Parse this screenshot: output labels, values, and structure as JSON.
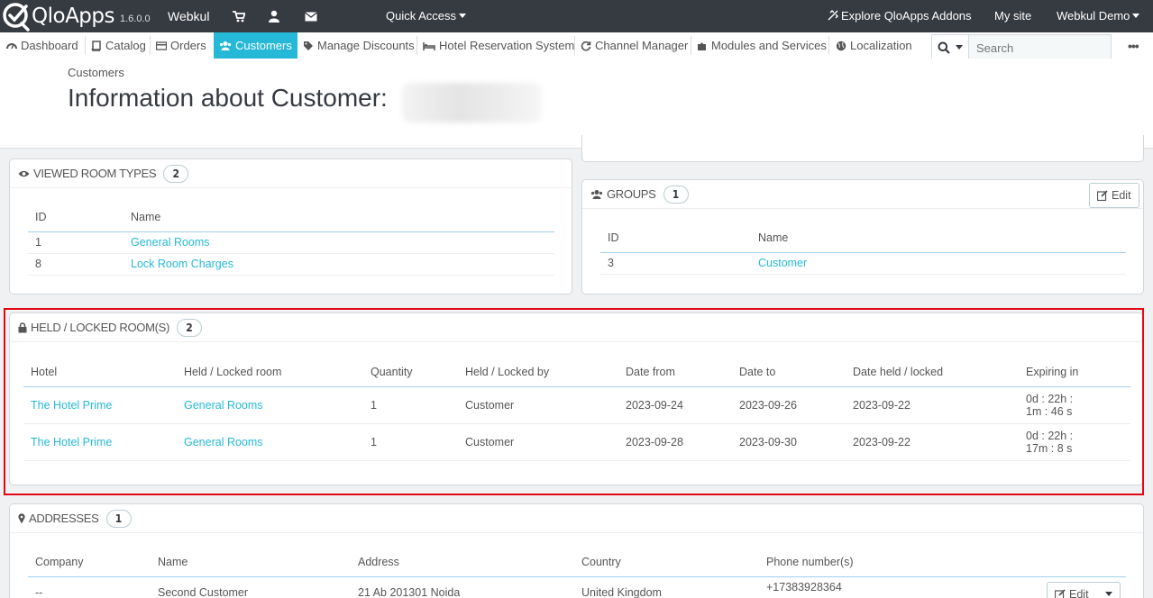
{
  "topbar": {
    "logo": "QloApps",
    "version": "1.6.0.0",
    "user": "Webkul",
    "quick_access": "Quick Access",
    "explore": "Explore QloApps Addons",
    "my_site": "My site",
    "account": "Webkul Demo"
  },
  "nav": {
    "items": [
      "Dashboard",
      "Catalog",
      "Orders",
      "Customers",
      "Manage Discounts",
      "Hotel Reservation System",
      "Channel Manager",
      "Modules and Services",
      "Localization"
    ],
    "active": "Customers",
    "search_placeholder": "Search",
    "more": "•••"
  },
  "header": {
    "breadcrumb": "Customers",
    "title": "Information about Customer:"
  },
  "viewed_room_types": {
    "title": "VIEWED ROOM TYPES",
    "count": "2",
    "columns": [
      "ID",
      "Name"
    ],
    "rows": [
      {
        "id": "1",
        "name": "General Rooms"
      },
      {
        "id": "8",
        "name": "Lock Room Charges"
      }
    ]
  },
  "groups": {
    "title": "GROUPS",
    "count": "1",
    "edit_label": "Edit",
    "columns": [
      "ID",
      "Name"
    ],
    "rows": [
      {
        "id": "3",
        "name": "Customer"
      }
    ]
  },
  "held_rooms": {
    "title": "HELD / LOCKED ROOM(S)",
    "count": "2",
    "columns": [
      "Hotel",
      "Held / Locked room",
      "Quantity",
      "Held / Locked by",
      "Date from",
      "Date to",
      "Date held / locked",
      "Expiring in"
    ],
    "rows": [
      {
        "hotel": "The Hotel Prime",
        "room": "General Rooms",
        "qty": "1",
        "by": "Customer",
        "from": "2023-09-24",
        "to": "2023-09-26",
        "held": "2023-09-22",
        "exp1": "0d : 22h :",
        "exp2": "1m : 46 s"
      },
      {
        "hotel": "The Hotel Prime",
        "room": "General Rooms",
        "qty": "1",
        "by": "Customer",
        "from": "2023-09-28",
        "to": "2023-09-30",
        "held": "2023-09-22",
        "exp1": "0d : 22h :",
        "exp2": "17m : 8 s"
      }
    ]
  },
  "addresses": {
    "title": "ADDRESSES",
    "count": "1",
    "columns": [
      "Company",
      "Name",
      "Address",
      "Country",
      "Phone number(s)"
    ],
    "rows": [
      {
        "company": "--",
        "name": "Second Customer",
        "address": "21 Ab 201301 Noida",
        "country": "United Kingdom",
        "phone": "+17383928364"
      }
    ],
    "edit_label": "Edit"
  },
  "colors": {
    "topbar": "#363a41",
    "accent": "#25b9d7",
    "highlight": "#e30613"
  }
}
